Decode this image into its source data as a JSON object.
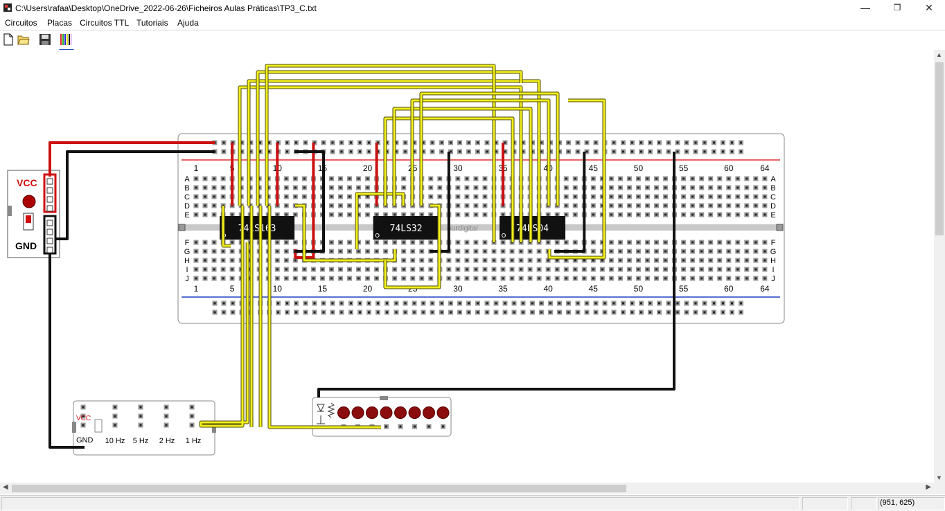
{
  "window": {
    "title": "C:\\Users\\rafaa\\Desktop\\OneDrive_2022-06-26\\Ficheiros Aulas Práticas\\TP3_C.txt",
    "minimize": "—",
    "maximize": "❐",
    "close": "✕"
  },
  "menu": [
    "Circuitos",
    "Placas",
    "Circuitos TTL",
    "Tutoriais",
    "Ajuda"
  ],
  "toolbar": {
    "icons": [
      "new-document-icon",
      "open-folder-icon",
      "save-floppy-icon",
      "wires-color-icon"
    ]
  },
  "power_module": {
    "vcc_label": "VCC",
    "gnd_label": "GND"
  },
  "breadboard": {
    "column_numbers": [
      "1",
      "5",
      "10",
      "15",
      "20",
      "25",
      "30",
      "35",
      "40",
      "45",
      "50",
      "55",
      "60",
      "64"
    ],
    "row_letters_top": [
      "A",
      "B",
      "C",
      "D",
      "E"
    ],
    "row_letters_bottom": [
      "F",
      "G",
      "H",
      "I",
      "J"
    ],
    "brand": "ourdigital"
  },
  "chips": [
    "74LS163",
    "74LS32",
    "74LS04"
  ],
  "clock_module": {
    "vcc_label": "VCC",
    "gnd_label": "GND",
    "frequencies": [
      "10 Hz",
      "5 Hz",
      "2 Hz",
      "1 Hz"
    ]
  },
  "led_module": {
    "led_count": 8
  },
  "status": {
    "coords": "(951, 625)"
  },
  "colors": {
    "wire_red": "#cc1111",
    "wire_black": "#111111",
    "wire_yellow": "#f2ee1c",
    "rail_red_line": "#e03030",
    "rail_blue_line": "#2040c0",
    "chip": "#111111",
    "led": "#8b0d0d"
  }
}
